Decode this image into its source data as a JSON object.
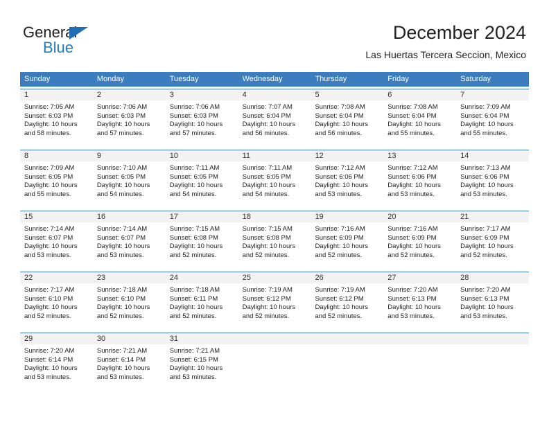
{
  "brand": {
    "name_dark": "General",
    "name_blue": "Blue",
    "accent_color": "#1f7dc4",
    "triangle_color": "#1f6db5"
  },
  "header": {
    "title": "December 2024",
    "subtitle": "Las Huertas Tercera Seccion, Mexico"
  },
  "colors": {
    "header_blue": "#3b7dbf",
    "date_strip_gray": "#f2f2f2",
    "text": "#222222"
  },
  "weekdays": [
    "Sunday",
    "Monday",
    "Tuesday",
    "Wednesday",
    "Thursday",
    "Friday",
    "Saturday"
  ],
  "weeks": [
    [
      {
        "date": "1",
        "sunrise": "Sunrise: 7:05 AM",
        "sunset": "Sunset: 6:03 PM",
        "daylight1": "Daylight: 10 hours",
        "daylight2": "and 58 minutes."
      },
      {
        "date": "2",
        "sunrise": "Sunrise: 7:06 AM",
        "sunset": "Sunset: 6:03 PM",
        "daylight1": "Daylight: 10 hours",
        "daylight2": "and 57 minutes."
      },
      {
        "date": "3",
        "sunrise": "Sunrise: 7:06 AM",
        "sunset": "Sunset: 6:03 PM",
        "daylight1": "Daylight: 10 hours",
        "daylight2": "and 57 minutes."
      },
      {
        "date": "4",
        "sunrise": "Sunrise: 7:07 AM",
        "sunset": "Sunset: 6:04 PM",
        "daylight1": "Daylight: 10 hours",
        "daylight2": "and 56 minutes."
      },
      {
        "date": "5",
        "sunrise": "Sunrise: 7:08 AM",
        "sunset": "Sunset: 6:04 PM",
        "daylight1": "Daylight: 10 hours",
        "daylight2": "and 56 minutes."
      },
      {
        "date": "6",
        "sunrise": "Sunrise: 7:08 AM",
        "sunset": "Sunset: 6:04 PM",
        "daylight1": "Daylight: 10 hours",
        "daylight2": "and 55 minutes."
      },
      {
        "date": "7",
        "sunrise": "Sunrise: 7:09 AM",
        "sunset": "Sunset: 6:04 PM",
        "daylight1": "Daylight: 10 hours",
        "daylight2": "and 55 minutes."
      }
    ],
    [
      {
        "date": "8",
        "sunrise": "Sunrise: 7:09 AM",
        "sunset": "Sunset: 6:05 PM",
        "daylight1": "Daylight: 10 hours",
        "daylight2": "and 55 minutes."
      },
      {
        "date": "9",
        "sunrise": "Sunrise: 7:10 AM",
        "sunset": "Sunset: 6:05 PM",
        "daylight1": "Daylight: 10 hours",
        "daylight2": "and 54 minutes."
      },
      {
        "date": "10",
        "sunrise": "Sunrise: 7:11 AM",
        "sunset": "Sunset: 6:05 PM",
        "daylight1": "Daylight: 10 hours",
        "daylight2": "and 54 minutes."
      },
      {
        "date": "11",
        "sunrise": "Sunrise: 7:11 AM",
        "sunset": "Sunset: 6:05 PM",
        "daylight1": "Daylight: 10 hours",
        "daylight2": "and 54 minutes."
      },
      {
        "date": "12",
        "sunrise": "Sunrise: 7:12 AM",
        "sunset": "Sunset: 6:06 PM",
        "daylight1": "Daylight: 10 hours",
        "daylight2": "and 53 minutes."
      },
      {
        "date": "13",
        "sunrise": "Sunrise: 7:12 AM",
        "sunset": "Sunset: 6:06 PM",
        "daylight1": "Daylight: 10 hours",
        "daylight2": "and 53 minutes."
      },
      {
        "date": "14",
        "sunrise": "Sunrise: 7:13 AM",
        "sunset": "Sunset: 6:06 PM",
        "daylight1": "Daylight: 10 hours",
        "daylight2": "and 53 minutes."
      }
    ],
    [
      {
        "date": "15",
        "sunrise": "Sunrise: 7:14 AM",
        "sunset": "Sunset: 6:07 PM",
        "daylight1": "Daylight: 10 hours",
        "daylight2": "and 53 minutes."
      },
      {
        "date": "16",
        "sunrise": "Sunrise: 7:14 AM",
        "sunset": "Sunset: 6:07 PM",
        "daylight1": "Daylight: 10 hours",
        "daylight2": "and 53 minutes."
      },
      {
        "date": "17",
        "sunrise": "Sunrise: 7:15 AM",
        "sunset": "Sunset: 6:08 PM",
        "daylight1": "Daylight: 10 hours",
        "daylight2": "and 52 minutes."
      },
      {
        "date": "18",
        "sunrise": "Sunrise: 7:15 AM",
        "sunset": "Sunset: 6:08 PM",
        "daylight1": "Daylight: 10 hours",
        "daylight2": "and 52 minutes."
      },
      {
        "date": "19",
        "sunrise": "Sunrise: 7:16 AM",
        "sunset": "Sunset: 6:09 PM",
        "daylight1": "Daylight: 10 hours",
        "daylight2": "and 52 minutes."
      },
      {
        "date": "20",
        "sunrise": "Sunrise: 7:16 AM",
        "sunset": "Sunset: 6:09 PM",
        "daylight1": "Daylight: 10 hours",
        "daylight2": "and 52 minutes."
      },
      {
        "date": "21",
        "sunrise": "Sunrise: 7:17 AM",
        "sunset": "Sunset: 6:09 PM",
        "daylight1": "Daylight: 10 hours",
        "daylight2": "and 52 minutes."
      }
    ],
    [
      {
        "date": "22",
        "sunrise": "Sunrise: 7:17 AM",
        "sunset": "Sunset: 6:10 PM",
        "daylight1": "Daylight: 10 hours",
        "daylight2": "and 52 minutes."
      },
      {
        "date": "23",
        "sunrise": "Sunrise: 7:18 AM",
        "sunset": "Sunset: 6:10 PM",
        "daylight1": "Daylight: 10 hours",
        "daylight2": "and 52 minutes."
      },
      {
        "date": "24",
        "sunrise": "Sunrise: 7:18 AM",
        "sunset": "Sunset: 6:11 PM",
        "daylight1": "Daylight: 10 hours",
        "daylight2": "and 52 minutes."
      },
      {
        "date": "25",
        "sunrise": "Sunrise: 7:19 AM",
        "sunset": "Sunset: 6:12 PM",
        "daylight1": "Daylight: 10 hours",
        "daylight2": "and 52 minutes."
      },
      {
        "date": "26",
        "sunrise": "Sunrise: 7:19 AM",
        "sunset": "Sunset: 6:12 PM",
        "daylight1": "Daylight: 10 hours",
        "daylight2": "and 52 minutes."
      },
      {
        "date": "27",
        "sunrise": "Sunrise: 7:20 AM",
        "sunset": "Sunset: 6:13 PM",
        "daylight1": "Daylight: 10 hours",
        "daylight2": "and 53 minutes."
      },
      {
        "date": "28",
        "sunrise": "Sunrise: 7:20 AM",
        "sunset": "Sunset: 6:13 PM",
        "daylight1": "Daylight: 10 hours",
        "daylight2": "and 53 minutes."
      }
    ],
    [
      {
        "date": "29",
        "sunrise": "Sunrise: 7:20 AM",
        "sunset": "Sunset: 6:14 PM",
        "daylight1": "Daylight: 10 hours",
        "daylight2": "and 53 minutes."
      },
      {
        "date": "30",
        "sunrise": "Sunrise: 7:21 AM",
        "sunset": "Sunset: 6:14 PM",
        "daylight1": "Daylight: 10 hours",
        "daylight2": "and 53 minutes."
      },
      {
        "date": "31",
        "sunrise": "Sunrise: 7:21 AM",
        "sunset": "Sunset: 6:15 PM",
        "daylight1": "Daylight: 10 hours",
        "daylight2": "and 53 minutes."
      },
      {
        "date": "",
        "sunrise": "",
        "sunset": "",
        "daylight1": "",
        "daylight2": ""
      },
      {
        "date": "",
        "sunrise": "",
        "sunset": "",
        "daylight1": "",
        "daylight2": ""
      },
      {
        "date": "",
        "sunrise": "",
        "sunset": "",
        "daylight1": "",
        "daylight2": ""
      },
      {
        "date": "",
        "sunrise": "",
        "sunset": "",
        "daylight1": "",
        "daylight2": ""
      }
    ]
  ]
}
